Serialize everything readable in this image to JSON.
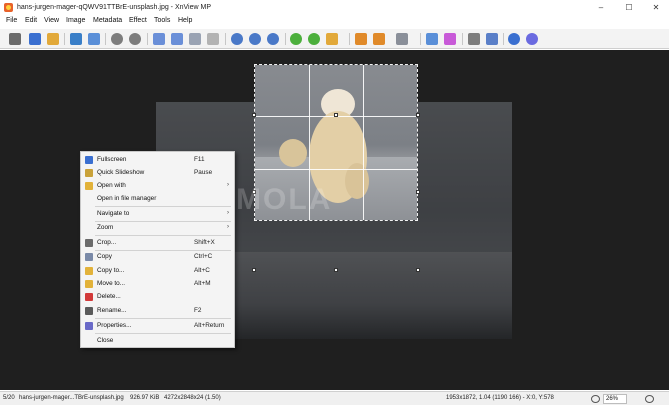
{
  "window": {
    "title": "hans-jurgen-mager-qQWV91TTBrE-unsplash.jpg - XnView MP",
    "minimize": "–",
    "maximize": "☐",
    "close": "✕"
  },
  "menu": [
    "File",
    "Edit",
    "View",
    "Image",
    "Metadata",
    "Effect",
    "Tools",
    "Help"
  ],
  "toolbar_icons": [
    "browser-icon",
    "fullscreen-icon",
    "open-folder-icon",
    "save-icon",
    "save-as-icon",
    "undo-icon",
    "redo-icon",
    "previous-icon",
    "next-icon",
    "copy-icon",
    "paste-icon",
    "zoom-out-icon",
    "zoom-in-icon",
    "zoom-fit-icon",
    "rotate-left-icon",
    "rotate-right-icon",
    "flip-icon",
    "crop-icon",
    "resize-icon",
    "adjust-icon",
    "info-icon",
    "edit-icon",
    "print-icon",
    "scan-icon",
    "settings-icon",
    "help-icon"
  ],
  "context_menu": {
    "items": [
      {
        "label": "Fullscreen",
        "shortcut": "F11",
        "icon": "fullscreen-icon",
        "color": "#3a6fd0"
      },
      {
        "label": "Quick Slideshow",
        "shortcut": "Pause",
        "icon": "slideshow-icon",
        "color": "#c9a23a"
      },
      {
        "label": "Open with",
        "shortcut": "",
        "icon": "open-folder-icon",
        "color": "#e2b23a",
        "submenu": true
      },
      {
        "label": "Open in file manager",
        "shortcut": "",
        "icon": "",
        "color": ""
      },
      {
        "label": "Navigate to",
        "shortcut": "",
        "icon": "",
        "color": "",
        "submenu": true
      },
      {
        "label": "Zoom",
        "shortcut": "",
        "icon": "",
        "color": "",
        "submenu": true
      },
      {
        "label": "Crop...",
        "shortcut": "Shift+X",
        "icon": "crop-icon",
        "color": "#6b6b6b"
      },
      {
        "label": "Copy",
        "shortcut": "Ctrl+C",
        "icon": "copy-icon",
        "color": "#7a8aa8"
      },
      {
        "label": "Copy to...",
        "shortcut": "Alt+C",
        "icon": "copy-to-icon",
        "color": "#e2b23a"
      },
      {
        "label": "Move to...",
        "shortcut": "Alt+M",
        "icon": "move-to-icon",
        "color": "#e2b23a"
      },
      {
        "label": "Delete...",
        "shortcut": "",
        "icon": "delete-icon",
        "color": "#d23a3a"
      },
      {
        "label": "Rename...",
        "shortcut": "F2",
        "icon": "rename-icon",
        "color": "#5a5a5a"
      },
      {
        "label": "Properties...",
        "shortcut": "Alt+Return",
        "icon": "properties-icon",
        "color": "#6a6ac8"
      },
      {
        "label": "Close",
        "shortcut": "",
        "icon": "",
        "color": ""
      }
    ],
    "arrow": "›"
  },
  "watermark": "SOFTMOLA",
  "status": {
    "index": "5/20",
    "filename": "hans-jurgen-mager...TBrE-unsplash.jpg",
    "filesize": "926.97 KiB",
    "dimensions": "4272x2848x24 (1.50)",
    "selection": "1953x1872, 1.04 (1190 166) - X:0, Y:578",
    "zoom": "26%"
  }
}
